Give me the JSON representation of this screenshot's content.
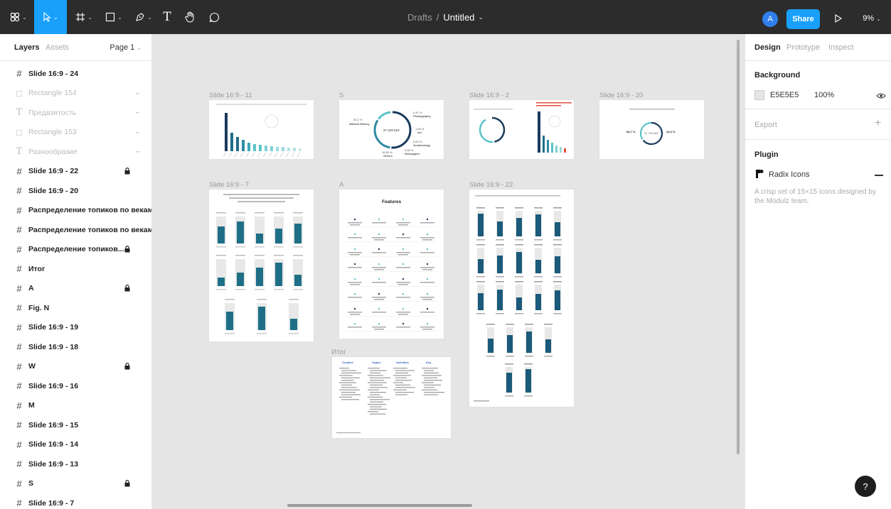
{
  "topbar": {
    "breadcrumb": "Drafts",
    "separator": "/",
    "file_name": "Untitled",
    "avatar_initial": "A",
    "share_label": "Share",
    "zoom": "9%"
  },
  "left_panel": {
    "tabs": [
      "Layers",
      "Assets"
    ],
    "page": "Page 1",
    "layers": [
      {
        "name": "Slide 16:9 - 24",
        "type": "frame"
      },
      {
        "name": "Rectangle 154",
        "type": "rect",
        "hidden": true
      },
      {
        "name": "Предвзятость",
        "type": "text",
        "hidden": true
      },
      {
        "name": "Rectangle 153",
        "type": "rect",
        "hidden": true
      },
      {
        "name": "Разнообразие",
        "type": "text",
        "hidden": true
      },
      {
        "name": "Slide 16:9 - 22",
        "type": "frame",
        "locked": true
      },
      {
        "name": "Slide 16:9 - 20",
        "type": "frame"
      },
      {
        "name": "Распределение топиков по векам",
        "type": "frame"
      },
      {
        "name": "Распределение топиков по векам",
        "type": "frame"
      },
      {
        "name": "Распределение топиков...",
        "type": "frame",
        "locked": true
      },
      {
        "name": "Итог",
        "type": "frame"
      },
      {
        "name": "A",
        "type": "frame",
        "locked": true
      },
      {
        "name": "Fig. N",
        "type": "frame"
      },
      {
        "name": "Slide 16:9 - 19",
        "type": "frame"
      },
      {
        "name": "Slide 16:9 - 18",
        "type": "frame"
      },
      {
        "name": "W",
        "type": "frame",
        "locked": true
      },
      {
        "name": "Slide 16:9 - 16",
        "type": "frame"
      },
      {
        "name": "M",
        "type": "frame"
      },
      {
        "name": "Slide 16:9 - 15",
        "type": "frame"
      },
      {
        "name": "Slide 16:9 - 14",
        "type": "frame"
      },
      {
        "name": "Slide 16:9 - 13",
        "type": "frame"
      },
      {
        "name": "S",
        "type": "frame",
        "locked": true
      },
      {
        "name": "Slide 16:9 - 7",
        "type": "frame"
      }
    ]
  },
  "canvas": {
    "frames": [
      {
        "label": "Slide 16:9 - 11"
      },
      {
        "label": "S"
      },
      {
        "label": "Slide 16:9 - 2"
      },
      {
        "label": "Slide 16:9 - 20"
      },
      {
        "label": "Slide 16:9 - 7"
      },
      {
        "label": "A"
      },
      {
        "label": "Slide 16:9 - 22"
      },
      {
        "label": "Итог"
      }
    ],
    "donut_s": {
      "center": "27 219 010",
      "labels": [
        "30,2 %\nNatural History",
        "0,41 %\nPhotography",
        "1,06 %\nArt",
        "0,63 %\nArchaeology",
        "0,66 %\nNewspaper",
        "16,59 %\nOthers"
      ]
    },
    "donut_20": {
      "center": "11 734 492",
      "left": "66,7 %",
      "right": "44,3 %"
    },
    "features_title": "Features",
    "slide7_title": "Соотношение топ-6 институций по отношению к общему количеству учетных записей по тематическим разделам",
    "itog_headers": [
      "Creative",
      "Topics",
      "Activities",
      "Key"
    ],
    "slide2_red_note": "Распределение тематических учетных записей"
  },
  "right_panel": {
    "tabs": [
      "Design",
      "Prototype",
      "Inspect"
    ],
    "background_heading": "Background",
    "background_hex": "E5E5E5",
    "background_opacity": "100%",
    "export_heading": "Export",
    "plugin_heading": "Plugin",
    "plugin_name": "Radix Icons",
    "plugin_desc": "A crisp set of 15×15 icons designed by the Modulz team."
  },
  "help_label": "?",
  "colors": {
    "accent": "#18a0fb",
    "topbar": "#2c2c2c",
    "canvas": "#e5e5e5",
    "navy": "#1b3a5c",
    "teal": "#1e6f86",
    "lightteal": "#5cc3c9"
  }
}
